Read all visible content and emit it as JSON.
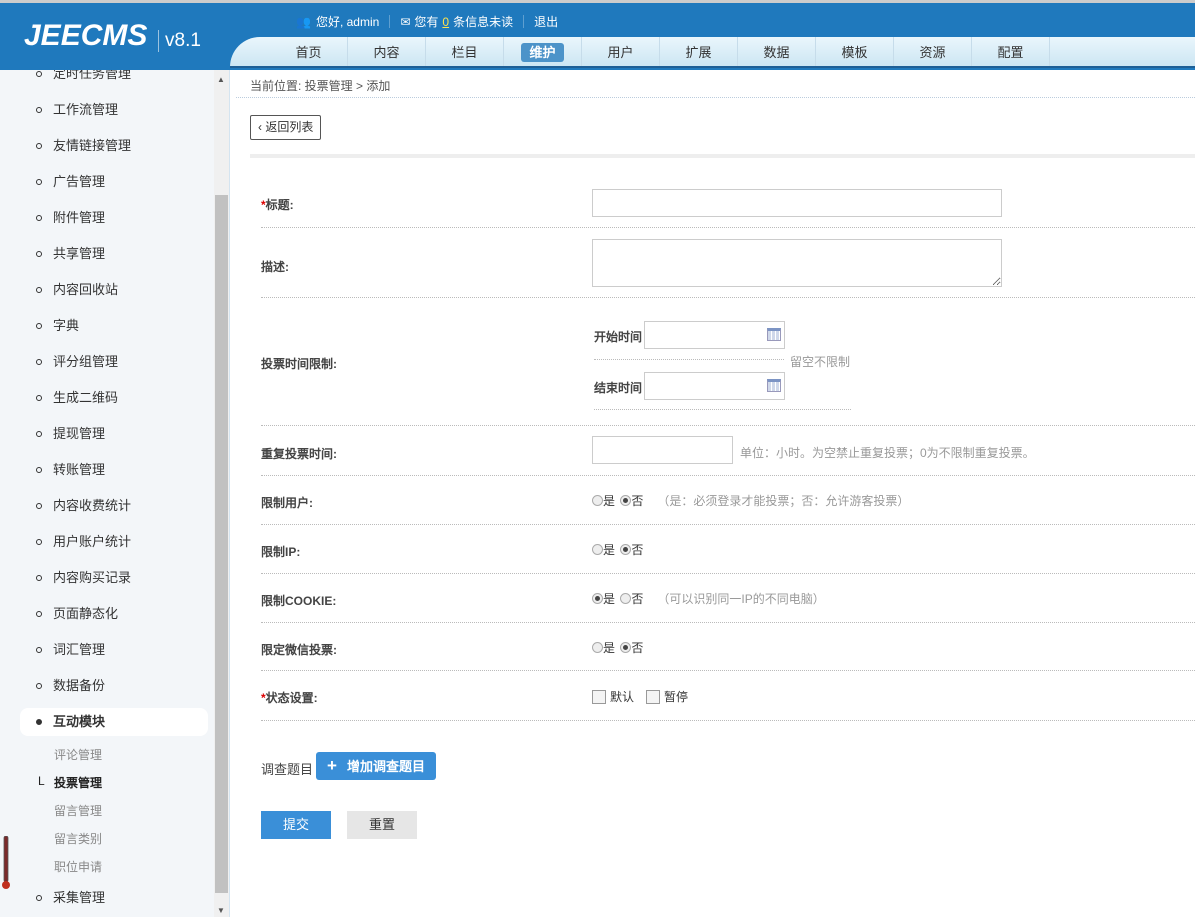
{
  "header": {
    "logo": "JEECMS",
    "version": "v8.1",
    "greeting": "您好, admin",
    "msg_prefix": "您有",
    "msg_count": "0",
    "msg_suffix": "条信息未读",
    "logout": "退出"
  },
  "nav": [
    "首页",
    "内容",
    "栏目",
    "维护",
    "用户",
    "扩展",
    "数据",
    "模板",
    "资源",
    "配置"
  ],
  "nav_active": "维护",
  "sidebar": {
    "items": [
      "定时任务管理",
      "工作流管理",
      "友情链接管理",
      "广告管理",
      "附件管理",
      "共享管理",
      "内容回收站",
      "字典",
      "评分组管理",
      "生成二维码",
      "提现管理",
      "转账管理",
      "内容收费统计",
      "用户账户统计",
      "内容购买记录",
      "页面静态化",
      "词汇管理",
      "数据备份"
    ],
    "active": "互动模块",
    "subs": [
      "评论管理",
      "投票管理",
      "留言管理",
      "留言类别",
      "职位申请"
    ],
    "sub_prefix": "L",
    "last": "采集管理"
  },
  "breadcrumb": "当前位置: 投票管理 > 添加",
  "back_button": "返回列表",
  "form": {
    "title_label": "标题:",
    "required_mark": "*",
    "desc_label": "描述:",
    "time_label": "投票时间限制:",
    "start_label": "开始时间",
    "end_label": "结束时间",
    "time_hint": "留空不限制",
    "repeat_label": "重复投票时间:",
    "repeat_hint": "单位：小时。为空禁止重复投票；0为不限制重复投票。",
    "yes": "是",
    "no": "否",
    "limit_user_label": "限制用户:",
    "limit_user_hint": "（是：必须登录才能投票；否：允许游客投票）",
    "limit_ip_label": "限制IP:",
    "limit_cookie_label": "限制COOKIE:",
    "limit_cookie_hint": "（可以识别同一IP的不同电脑）",
    "wechat_label": "限定微信投票:",
    "status_label": "状态设置:",
    "status_default": "默认",
    "status_pause": "暂停",
    "survey_label": "调查题目",
    "add_survey": "增加调查题目",
    "add_icon": "+",
    "submit": "提交",
    "reset": "重置"
  }
}
